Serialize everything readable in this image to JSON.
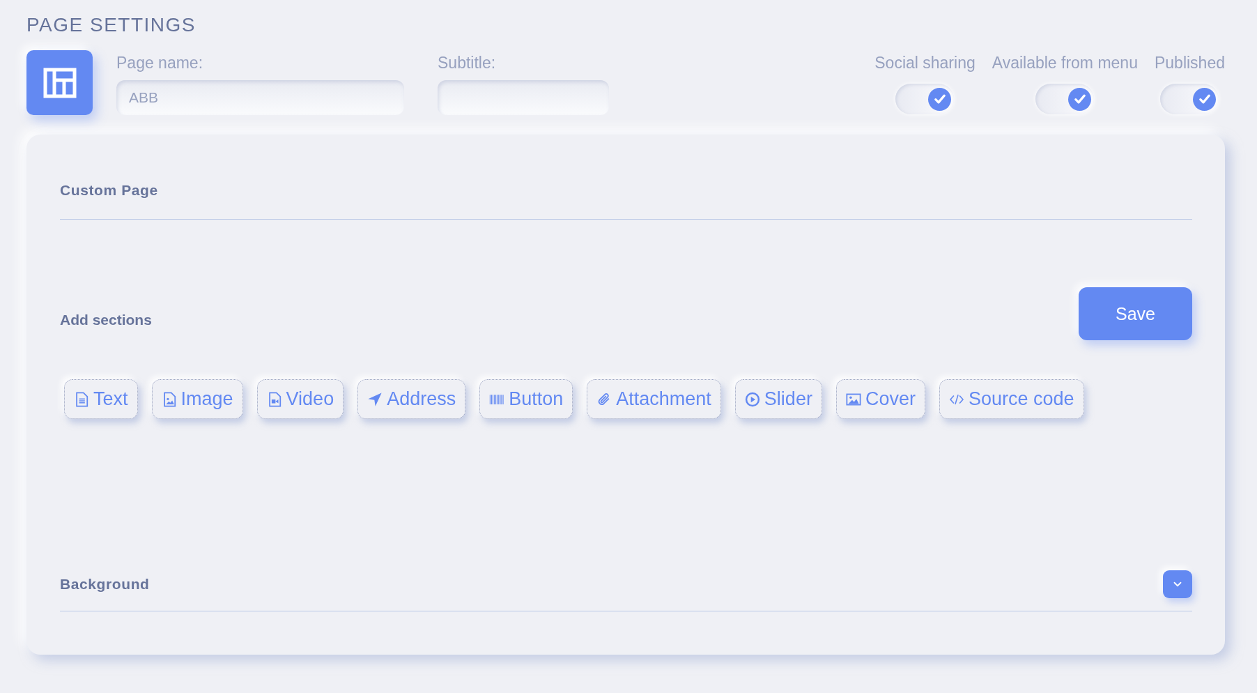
{
  "page_title": "PAGE SETTINGS",
  "fields": [
    {
      "label": "Page name:",
      "value": "ABB"
    },
    {
      "label": "Subtitle:"
    }
  ],
  "toggles": [
    {
      "label": "Social sharing",
      "on": true
    },
    {
      "label": "Available from menu",
      "on": true
    },
    {
      "label": "Published",
      "on": true
    }
  ],
  "custom_page": {
    "title": "Custom Page"
  },
  "add_sections": {
    "title": "Add sections",
    "save_button": "Save",
    "buttons": [
      {
        "kind": "text",
        "label": "Text"
      },
      {
        "kind": "image",
        "label": "Image"
      },
      {
        "kind": "video",
        "label": "Video"
      },
      {
        "kind": "address",
        "label": "Address"
      },
      {
        "kind": "button",
        "label": "Button"
      },
      {
        "kind": "attachment",
        "label": "Attachment"
      },
      {
        "kind": "slider",
        "label": "Slider"
      },
      {
        "kind": "cover",
        "label": "Cover"
      },
      {
        "kind": "code",
        "label": "Source code"
      }
    ]
  },
  "background": {
    "title": "Background",
    "expanded": false
  }
}
